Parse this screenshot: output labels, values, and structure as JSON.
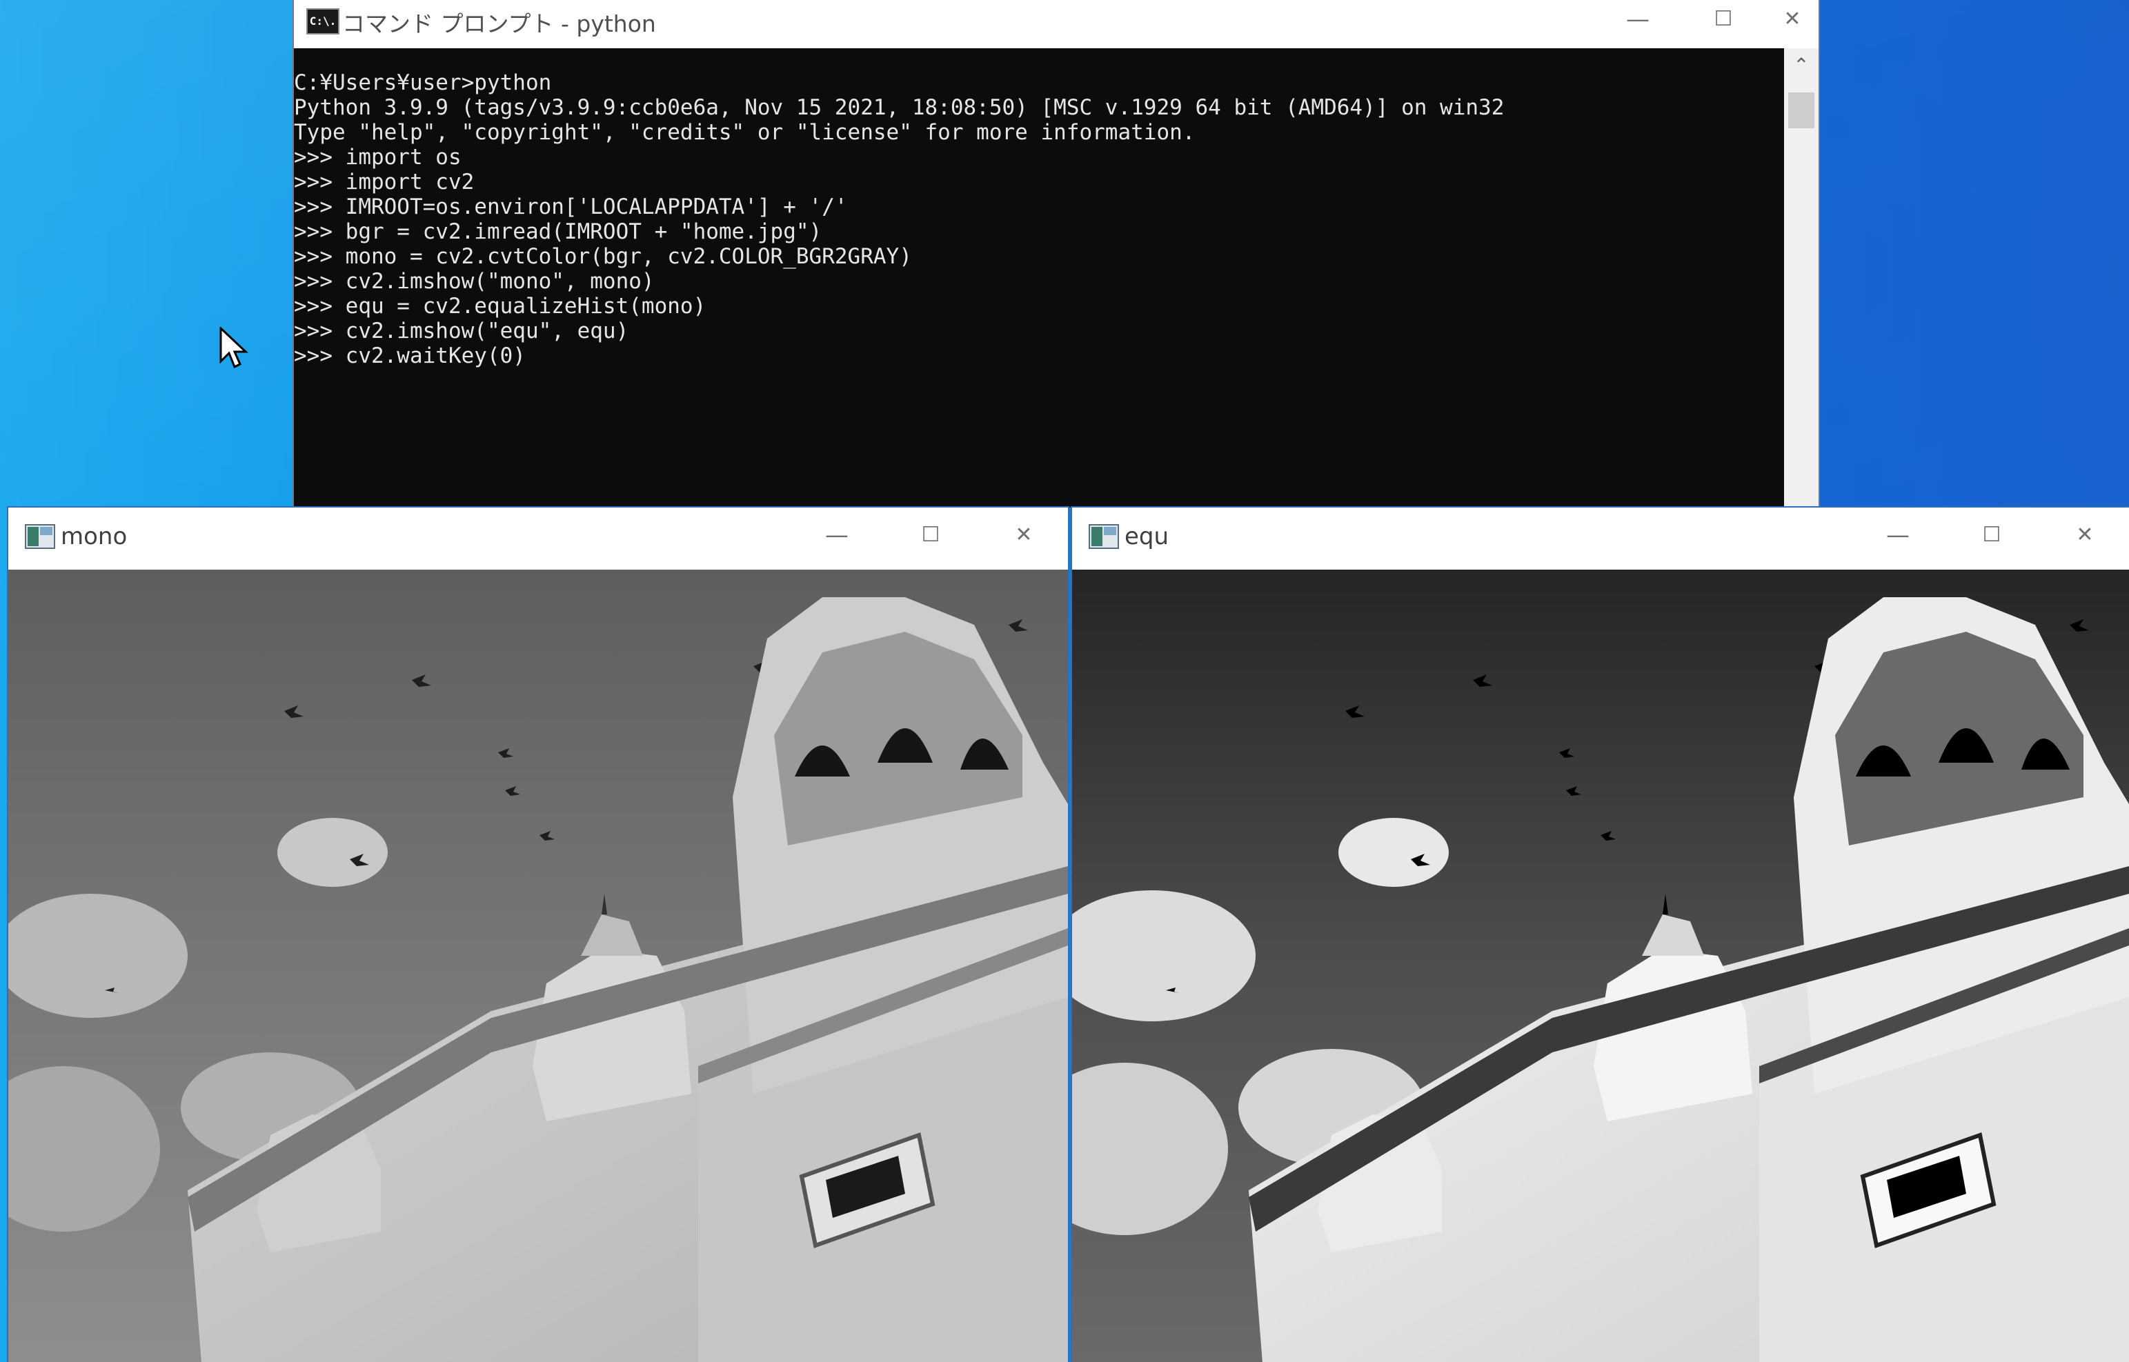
{
  "cmd": {
    "title": "コマンド プロンプト - python",
    "icon": "cmd-icon",
    "icon_text": "C:\\.",
    "console_lines": [
      "C:¥Users¥user>python",
      "Python 3.9.9 (tags/v3.9.9:ccb0e6a, Nov 15 2021, 18:08:50) [MSC v.1929 64 bit (AMD64)] on win32",
      "Type \"help\", \"copyright\", \"credits\" or \"license\" for more information.",
      ">>> import os",
      ">>> import cv2",
      ">>> IMROOT=os.environ['LOCALAPPDATA'] + '/'",
      ">>> bgr = cv2.imread(IMROOT + \"home.jpg\")",
      ">>> mono = cv2.cvtColor(bgr, cv2.COLOR_BGR2GRAY)",
      ">>> cv2.imshow(\"mono\", mono)",
      ">>> equ = cv2.equalizeHist(mono)",
      ">>> cv2.imshow(\"equ\", equ)",
      ">>> cv2.waitKey(0)"
    ],
    "minimize_glyph": "—",
    "maximize_glyph": "☐",
    "close_glyph": "✕",
    "scroll_up_glyph": "⌃"
  },
  "windows": [
    {
      "id": "mono",
      "title": "mono",
      "icon": "image-window-icon",
      "minimize_glyph": "—",
      "maximize_glyph": "☐",
      "close_glyph": "✕"
    },
    {
      "id": "equ",
      "title": "equ",
      "icon": "image-window-icon",
      "minimize_glyph": "—",
      "maximize_glyph": "☐",
      "close_glyph": "✕"
    }
  ],
  "colors": {
    "desktop": "#0d8de6",
    "console_bg": "#0c0c0c",
    "console_text": "#e6e6e6",
    "window_border": "#2f6fb7"
  },
  "cursor_icon": "mouse-pointer-icon"
}
